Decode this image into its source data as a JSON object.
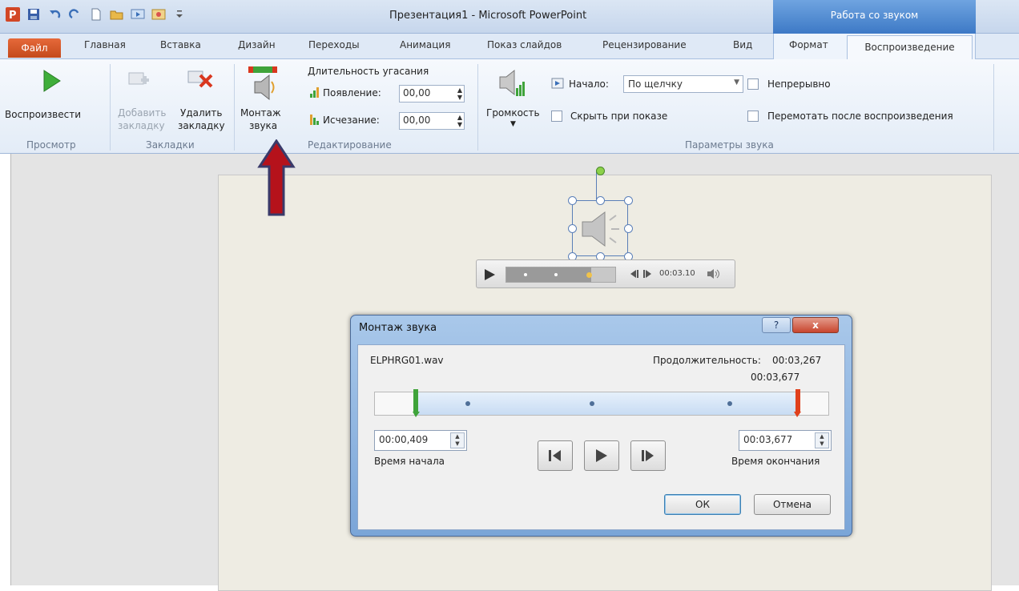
{
  "window": {
    "title": "Презентация1 - Microsoft PowerPoint",
    "context_tab_group": "Работа со звуком"
  },
  "tabs": {
    "file": "Файл",
    "items": [
      "Главная",
      "Вставка",
      "Дизайн",
      "Переходы",
      "Анимация",
      "Показ слайдов",
      "Рецензирование",
      "Вид"
    ],
    "context": [
      "Формат",
      "Воспроизведение"
    ],
    "active": "Воспроизведение"
  },
  "ribbon": {
    "preview": {
      "play_label": "Воспроизвести",
      "group": "Просмотр"
    },
    "bookmarks": {
      "add_line1": "Добавить",
      "add_line2": "закладку",
      "remove_line1": "Удалить",
      "remove_line2": "закладку",
      "group": "Закладки"
    },
    "editing": {
      "trim_line1": "Монтаж",
      "trim_line2": "звука",
      "fade_title": "Длительность угасания",
      "fade_in_label": "Появление:",
      "fade_in_value": "00,00",
      "fade_out_label": "Исчезание:",
      "fade_out_value": "00,00",
      "group": "Редактирование"
    },
    "audio_options": {
      "volume_label": "Громкость",
      "start_label": "Начало:",
      "start_value": "По щелчку",
      "loop_label": "Непрерывно",
      "hide_label": "Скрыть при показе",
      "rewind_label": "Перемотать после воспроизведения",
      "group": "Параметры звука"
    }
  },
  "player": {
    "time": "00:03.10",
    "progress_fraction": 0.78
  },
  "dialog": {
    "title": "Монтаж звука",
    "help": "?",
    "close": "x",
    "filename": "ELPHRG01.wav",
    "duration_label": "Продолжительность:",
    "duration_value": "00:03,267",
    "marker_time": "00:03,677",
    "start_time": "00:00,409",
    "start_label": "Время начала",
    "end_time": "00:03,677",
    "end_label": "Время окончания",
    "ok": "ОК",
    "cancel": "Отмена"
  },
  "colors": {
    "file_tab": "#d4582a",
    "arrow": "#b5121b",
    "context": "#3d79c6",
    "start_marker": "#3fa33a",
    "end_marker": "#e0401c"
  }
}
